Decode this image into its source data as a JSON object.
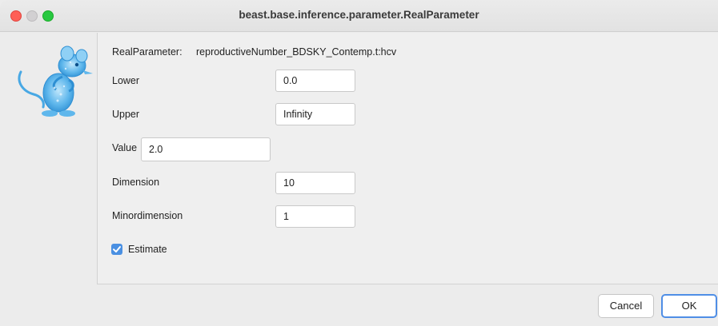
{
  "window": {
    "title": "beast.base.inference.parameter.RealParameter"
  },
  "header": {
    "parameter_label": "RealParameter:",
    "parameter_id": "reproductiveNumber_BDSKY_Contemp.t:hcv"
  },
  "fields": {
    "lower": {
      "label": "Lower",
      "value": "0.0"
    },
    "upper": {
      "label": "Upper",
      "value": "Infinity"
    },
    "value": {
      "label": "Value",
      "value": "2.0"
    },
    "dimension": {
      "label": "Dimension",
      "value": "10"
    },
    "minordimension": {
      "label": "Minordimension",
      "value": "1"
    }
  },
  "estimate": {
    "label": "Estimate",
    "checked": true
  },
  "buttons": {
    "cancel": "Cancel",
    "ok": "OK"
  },
  "colors": {
    "accent": "#4a90e2",
    "close": "#fe5f57",
    "maximize": "#28c840"
  }
}
